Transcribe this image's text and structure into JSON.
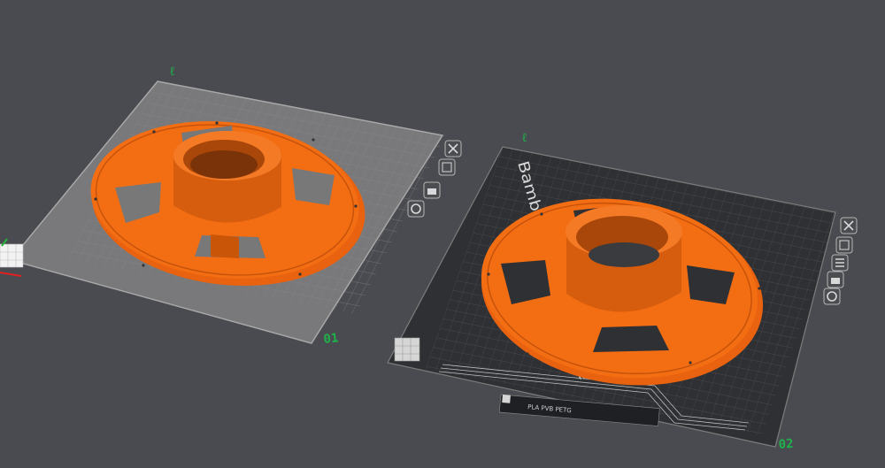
{
  "viewport": {
    "background_color": "#4a4b50",
    "model_color": "#f36d13",
    "plate_number_color": "#1fb14a"
  },
  "plates": [
    {
      "number": "01",
      "type": "default-grid-plate",
      "buttons": [
        "close-icon",
        "auto-arrange-icon",
        "lock-icon",
        "settings-gear-icon"
      ]
    },
    {
      "number": "02",
      "type": "textured-pei-plate",
      "title": "Bambu Textured PEI Plate",
      "material_text": "PLA PVB PETG",
      "buttons": [
        "close-icon",
        "auto-arrange-icon",
        "plate-list-icon",
        "lock-icon",
        "settings-gear-icon"
      ]
    }
  ]
}
